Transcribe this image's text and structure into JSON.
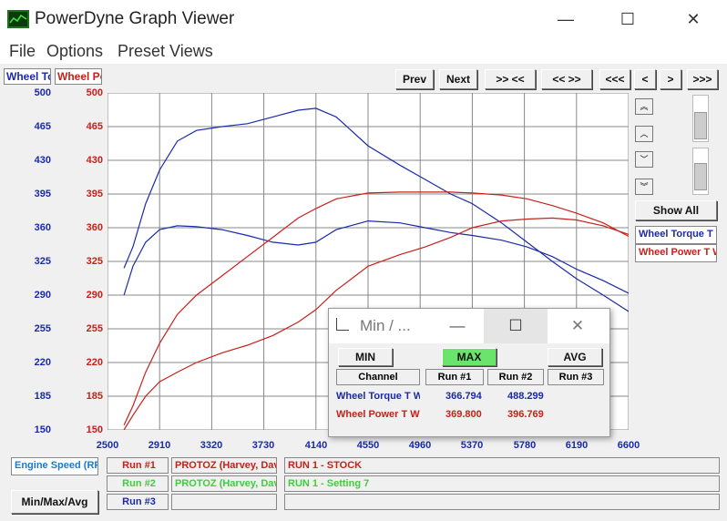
{
  "window": {
    "title": "PowerDyne Graph Viewer",
    "minimize": "—",
    "maximize": "☐",
    "close": "✕"
  },
  "menu": [
    "File",
    "Options",
    "Preset Views"
  ],
  "tabs": [
    {
      "label": "Wheel To",
      "color": "#1a2aa8"
    },
    {
      "label": "Wheel Po",
      "color": "#c8201a"
    }
  ],
  "nav": {
    "prev": "Prev",
    "next": "Next",
    "zoom_in": ">> <<",
    "zoom_out": "<< >>",
    "first": "<<<",
    "left": "<",
    "right": ">",
    "last": ">>>"
  },
  "side": {
    "show_all": "Show All",
    "channel1": "Wheel Torque T",
    "channel2": "Wheel Power T W"
  },
  "bottom": {
    "x_channel": "Engine Speed (RPM)",
    "minmax_button": "Min/Max/Avg",
    "runs": [
      {
        "label": "Run #1",
        "color": "#c8201a",
        "owner": "PROTOZ (Harvey, David)",
        "desc": "RUN 1 - STOCK"
      },
      {
        "label": "Run #2",
        "color": "#3ccf3c",
        "owner": "PROTOZ (Harvey, David)",
        "desc": "RUN 1 - Setting 7"
      },
      {
        "label": "Run #3",
        "color": "#1a2aa8",
        "owner": "",
        "desc": ""
      }
    ]
  },
  "dialog": {
    "title": "Min / ...",
    "min": "MIN",
    "max": "MAX",
    "avg": "AVG",
    "headers": [
      "Channel",
      "Run #1",
      "Run #2",
      "Run #3"
    ],
    "rows": [
      {
        "channel": "Wheel Torque T W",
        "run1": "366.794",
        "run2": "488.299",
        "run3": "",
        "color": "#1a2aa8"
      },
      {
        "channel": "Wheel Power T W",
        "run1": "369.800",
        "run2": "396.769",
        "run3": "",
        "color": "#c8201a"
      }
    ]
  },
  "chart_data": {
    "type": "line",
    "x_ticks": [
      2500,
      2910,
      3320,
      3730,
      4140,
      4550,
      4960,
      5370,
      5780,
      6190,
      6600
    ],
    "y_ticks_torque": [
      500,
      465,
      430,
      395,
      360,
      325,
      290,
      255,
      220,
      185,
      150
    ],
    "y_ticks_power": [
      500,
      465,
      430,
      395,
      360,
      325,
      290,
      255,
      220,
      185,
      150
    ],
    "xlim": [
      2500,
      6600
    ],
    "ylim": [
      150,
      500
    ],
    "grid": true,
    "series": [
      {
        "color": "#1a2aa8",
        "x": [
          2630,
          2700,
          2800,
          2910,
          3050,
          3200,
          3400,
          3600,
          3800,
          4000,
          4140,
          4300,
          4550,
          4800,
          5000,
          5200,
          5370,
          5600,
          5800,
          6000,
          6190,
          6400,
          6600
        ],
        "y": [
          318,
          340,
          385,
          420,
          450,
          461,
          465,
          468,
          475,
          482,
          484,
          475,
          445,
          425,
          410,
          395,
          385,
          365,
          345,
          325,
          307,
          290,
          273
        ]
      },
      {
        "color": "#1a2aa8",
        "x": [
          2630,
          2700,
          2800,
          2910,
          3050,
          3200,
          3400,
          3600,
          3800,
          4000,
          4140,
          4300,
          4550,
          4800,
          5000,
          5200,
          5370,
          5600,
          5800,
          6000,
          6190,
          6400,
          6600
        ],
        "y": [
          290,
          320,
          345,
          358,
          362,
          361,
          358,
          352,
          345,
          342,
          345,
          358,
          367,
          365,
          360,
          355,
          352,
          347,
          340,
          330,
          317,
          305,
          292
        ]
      },
      {
        "color": "#c8201a",
        "x": [
          2630,
          2700,
          2800,
          2910,
          3050,
          3200,
          3400,
          3600,
          3800,
          4000,
          4140,
          4300,
          4550,
          4800,
          5000,
          5200,
          5370,
          5600,
          5800,
          6000,
          6190,
          6400,
          6600
        ],
        "y": [
          155,
          175,
          210,
          240,
          270,
          290,
          310,
          330,
          350,
          370,
          380,
          390,
          396,
          397,
          397,
          397,
          396,
          394,
          390,
          383,
          375,
          365,
          351
        ]
      },
      {
        "color": "#c8201a",
        "x": [
          2630,
          2700,
          2800,
          2910,
          3050,
          3200,
          3400,
          3600,
          3800,
          4000,
          4140,
          4300,
          4550,
          4800,
          5000,
          5200,
          5370,
          5600,
          5800,
          6000,
          6190,
          6400,
          6600
        ],
        "y": [
          150,
          165,
          185,
          200,
          210,
          220,
          230,
          238,
          248,
          262,
          275,
          295,
          320,
          332,
          340,
          350,
          360,
          367,
          369,
          370,
          368,
          362,
          353
        ]
      }
    ]
  }
}
